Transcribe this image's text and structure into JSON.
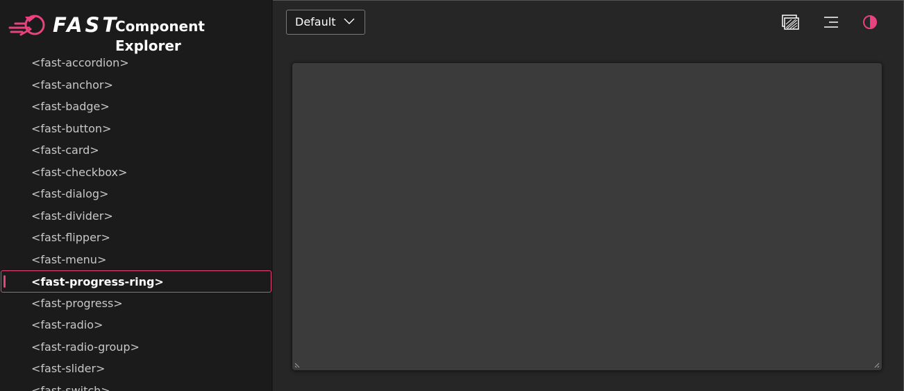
{
  "brand": {
    "wordmark": "FAST",
    "title": "Component Explorer",
    "accent_color": "#e8427f",
    "logo_icon": "fast-rocket-logo"
  },
  "sidebar": {
    "items": [
      {
        "label": "<fast-accordion>"
      },
      {
        "label": "<fast-anchor>"
      },
      {
        "label": "<fast-badge>"
      },
      {
        "label": "<fast-button>"
      },
      {
        "label": "<fast-card>"
      },
      {
        "label": "<fast-checkbox>"
      },
      {
        "label": "<fast-dialog>"
      },
      {
        "label": "<fast-divider>"
      },
      {
        "label": "<fast-flipper>"
      },
      {
        "label": "<fast-menu>"
      },
      {
        "label": "<fast-progress-ring>",
        "selected": true
      },
      {
        "label": "<fast-progress>"
      },
      {
        "label": "<fast-radio>"
      },
      {
        "label": "<fast-radio-group>"
      },
      {
        "label": "<fast-slider>"
      },
      {
        "label": "<fast-switch>"
      }
    ]
  },
  "toolbar": {
    "theme_select_value": "Default",
    "icons": [
      "transparency-grid-icon",
      "menu-lines-icon",
      "contrast-toggle-icon"
    ]
  }
}
